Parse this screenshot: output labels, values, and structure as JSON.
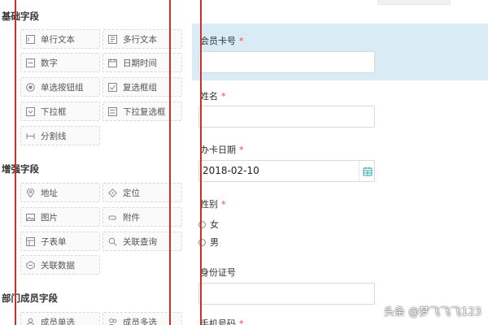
{
  "palette": {
    "groups": [
      {
        "title": "基础字段",
        "items": [
          {
            "label": "单行文本",
            "icon": "single-line-text-icon"
          },
          {
            "label": "多行文本",
            "icon": "multi-line-text-icon"
          },
          {
            "label": "数字",
            "icon": "number-icon"
          },
          {
            "label": "日期时间",
            "icon": "datetime-icon"
          },
          {
            "label": "单选按钮组",
            "icon": "radio-group-icon"
          },
          {
            "label": "复选框组",
            "icon": "checkbox-group-icon"
          },
          {
            "label": "下拉框",
            "icon": "dropdown-icon"
          },
          {
            "label": "下拉复选框",
            "icon": "dropdown-checkbox-icon"
          },
          {
            "label": "分割线",
            "icon": "divider-icon"
          }
        ]
      },
      {
        "title": "增强字段",
        "items": [
          {
            "label": "地址",
            "icon": "location-pin-icon"
          },
          {
            "label": "定位",
            "icon": "target-icon"
          },
          {
            "label": "图片",
            "icon": "image-icon"
          },
          {
            "label": "附件",
            "icon": "attachment-icon"
          },
          {
            "label": "子表单",
            "icon": "subform-icon"
          },
          {
            "label": "关联查询",
            "icon": "link-search-icon"
          },
          {
            "label": "关联数据",
            "icon": "link-data-icon"
          }
        ]
      },
      {
        "title": "部门成员字段",
        "items": [
          {
            "label": "成员单选",
            "icon": "member-icon"
          },
          {
            "label": "成员多选",
            "icon": "members-icon"
          }
        ]
      }
    ]
  },
  "form": {
    "fields": [
      {
        "label": "会员卡号",
        "required": "*"
      },
      {
        "label": "姓名",
        "required": "*"
      },
      {
        "label": "办卡日期",
        "required": "*",
        "value": "2018-02-10"
      },
      {
        "label": "性别",
        "required": "*",
        "options": [
          "女",
          "男"
        ]
      },
      {
        "label": "身份证号",
        "required": ""
      },
      {
        "label": "手机号码",
        "required": "*"
      }
    ]
  },
  "watermark": "头条 @梦飞飞飞123",
  "colors": {
    "selected_bg": "#d9ebf4",
    "marker_red": "#c9302c",
    "required_red": "#e34b4b"
  }
}
